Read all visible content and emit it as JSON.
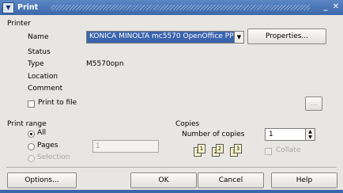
{
  "window": {
    "title": "Print",
    "min_glyph": "_",
    "close_glyph": "✕"
  },
  "printer": {
    "section_label": "Printer",
    "name_label": "Name",
    "name_value": "KONICA MINOLTA mc5570 OpenOffice PP",
    "properties_label": "Properties...",
    "status_label": "Status",
    "status_value": "",
    "type_label": "Type",
    "type_value": "M5570opn",
    "location_label": "Location",
    "location_value": "",
    "comment_label": "Comment",
    "comment_value": "",
    "print_to_file_label": "Print to file",
    "print_to_file_checked": false,
    "browse_label": "..."
  },
  "print_range": {
    "section_label": "Print range",
    "all_label": "All",
    "pages_label": "Pages",
    "pages_value": "1",
    "selection_label": "Selection",
    "selected": "All"
  },
  "copies": {
    "section_label": "Copies",
    "number_label": "Number of copies",
    "number_value": "1",
    "collate_label": "Collate",
    "collate_checked": false,
    "page_numbers": [
      "1",
      "1",
      "2",
      "2",
      "3",
      "3"
    ]
  },
  "buttons": {
    "options": "Options...",
    "ok": "OK",
    "cancel": "Cancel",
    "help": "Help"
  },
  "colors": {
    "titlebar": "#3c68ab",
    "selection": "#3a64ad",
    "dialog_bg": "#e8e6e2"
  }
}
